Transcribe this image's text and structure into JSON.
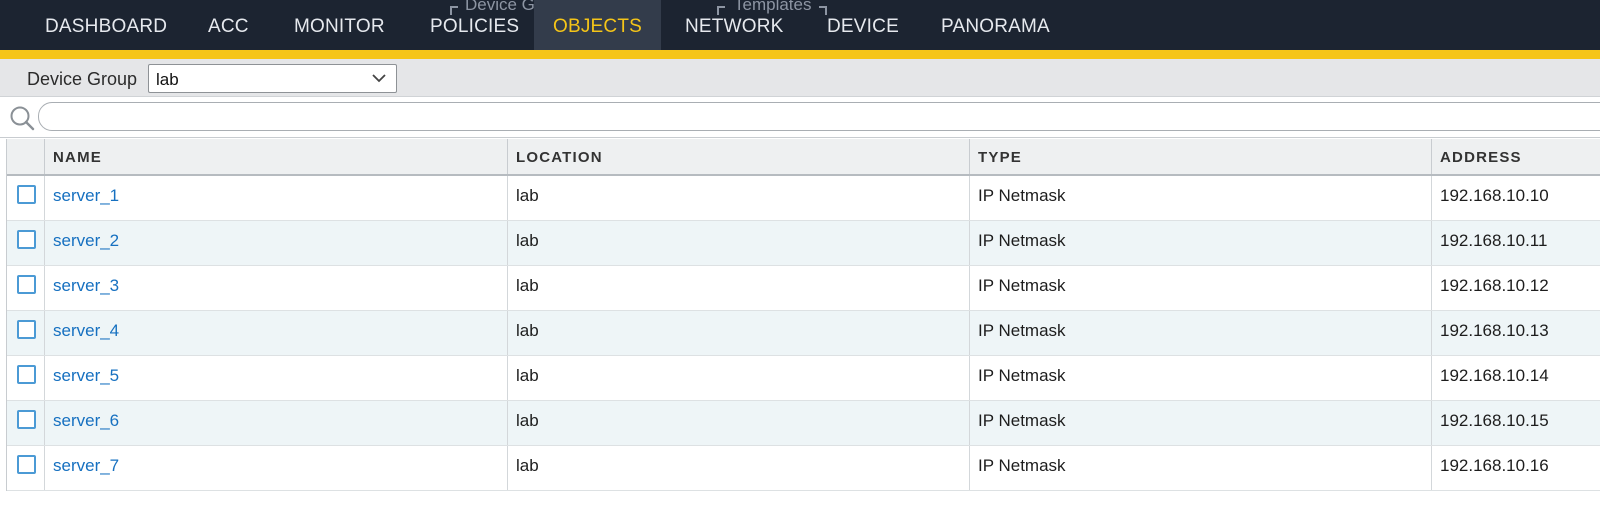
{
  "nav": {
    "tabs": [
      {
        "id": "dashboard",
        "label": "DASHBOARD"
      },
      {
        "id": "acc",
        "label": "ACC"
      },
      {
        "id": "monitor",
        "label": "MONITOR"
      },
      {
        "id": "policies",
        "label": "POLICIES"
      },
      {
        "id": "objects",
        "label": "OBJECTS",
        "active": true
      },
      {
        "id": "network",
        "label": "NETWORK"
      },
      {
        "id": "device",
        "label": "DEVICE"
      },
      {
        "id": "panorama",
        "label": "PANORAMA"
      }
    ],
    "group_labels": {
      "device_groups": "Device Groups",
      "templates": "Templates"
    },
    "accent_color": "#f5c518",
    "background_color": "#1c2431"
  },
  "device_group": {
    "label": "Device Group",
    "selected": "lab",
    "icon": "chevron-down-icon"
  },
  "filter": {
    "icon": "search-icon",
    "value": "",
    "placeholder": ""
  },
  "table": {
    "columns": [
      "NAME",
      "LOCATION",
      "TYPE",
      "ADDRESS"
    ],
    "rows": [
      {
        "name": "server_1",
        "location": "lab",
        "type": "IP Netmask",
        "address": "192.168.10.10"
      },
      {
        "name": "server_2",
        "location": "lab",
        "type": "IP Netmask",
        "address": "192.168.10.11"
      },
      {
        "name": "server_3",
        "location": "lab",
        "type": "IP Netmask",
        "address": "192.168.10.12"
      },
      {
        "name": "server_4",
        "location": "lab",
        "type": "IP Netmask",
        "address": "192.168.10.13"
      },
      {
        "name": "server_5",
        "location": "lab",
        "type": "IP Netmask",
        "address": "192.168.10.14"
      },
      {
        "name": "server_6",
        "location": "lab",
        "type": "IP Netmask",
        "address": "192.168.10.15"
      },
      {
        "name": "server_7",
        "location": "lab",
        "type": "IP Netmask",
        "address": "192.168.10.16"
      }
    ],
    "link_color": "#1670c0"
  }
}
